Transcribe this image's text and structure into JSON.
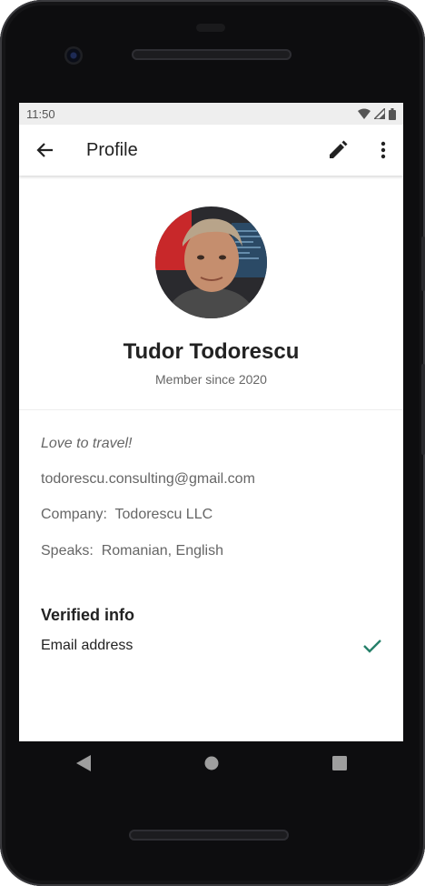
{
  "status_bar": {
    "time": "11:50"
  },
  "app_bar": {
    "title": "Profile",
    "back_icon": "arrow-back-icon",
    "edit_icon": "pencil-icon",
    "more_icon": "more-vert-icon"
  },
  "profile": {
    "name": "Tudor Todorescu",
    "member_since": "Member since 2020",
    "tagline": "Love to travel!",
    "email": "todorescu.consulting@gmail.com",
    "company_label": "Company:",
    "company": "Todorescu LLC",
    "speaks_label": "Speaks:",
    "languages": "Romanian, English"
  },
  "verified": {
    "title": "Verified info",
    "items": [
      {
        "label": "Email address",
        "icon": "check-icon"
      }
    ]
  },
  "colors": {
    "accent": "#26806a",
    "text_primary": "#222222",
    "text_secondary": "#666666"
  }
}
